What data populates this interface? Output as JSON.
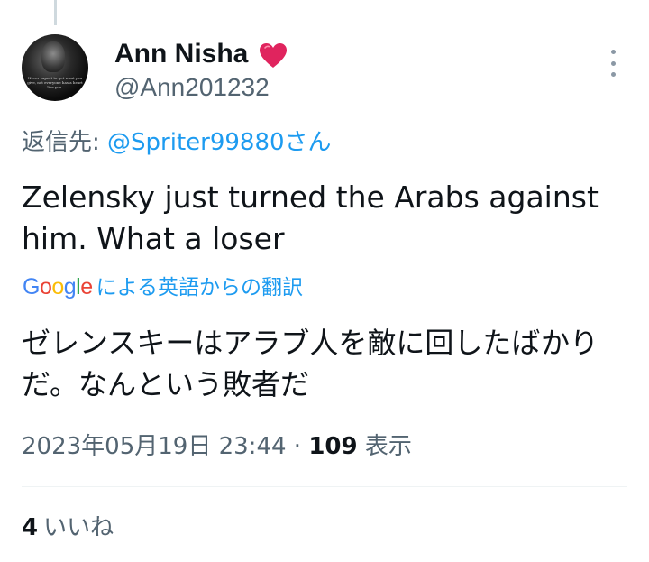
{
  "author": {
    "display_name": "Ann Nisha",
    "handle": "@Ann201232",
    "avatar_quote": "Never expect to get what you give, not everyone has a heart like you."
  },
  "reply": {
    "prefix": "返信先: ",
    "mention": "@Spriter99880さん"
  },
  "tweet": {
    "text": "Zelensky just turned the Arabs against him. What a loser"
  },
  "translation": {
    "google_letters": [
      "G",
      "o",
      "o",
      "g",
      "l",
      "e"
    ],
    "label": "による英語からの翻訳",
    "text": "ゼレンスキーはアラブ人を敵に回したばかりだ。なんという敗者だ"
  },
  "meta": {
    "timestamp": "2023年05月19日 23:44",
    "separator": " · ",
    "views_count": "109",
    "views_label": " 表示"
  },
  "stats": {
    "likes_count": "4",
    "likes_label": "いいね"
  },
  "icons": {
    "heart": "heart-icon",
    "more": "more-icon"
  },
  "colors": {
    "link": "#1d9bf0",
    "secondary_text": "#536471",
    "heart": "#e0245e"
  }
}
